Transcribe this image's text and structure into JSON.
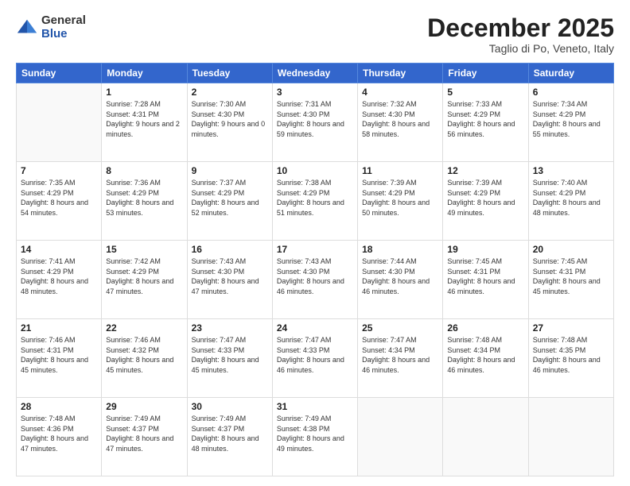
{
  "logo": {
    "general": "General",
    "blue": "Blue"
  },
  "header": {
    "month": "December 2025",
    "location": "Taglio di Po, Veneto, Italy"
  },
  "days_of_week": [
    "Sunday",
    "Monday",
    "Tuesday",
    "Wednesday",
    "Thursday",
    "Friday",
    "Saturday"
  ],
  "weeks": [
    [
      {
        "day": "",
        "sunrise": "",
        "sunset": "",
        "daylight": ""
      },
      {
        "day": "1",
        "sunrise": "Sunrise: 7:28 AM",
        "sunset": "Sunset: 4:31 PM",
        "daylight": "Daylight: 9 hours and 2 minutes."
      },
      {
        "day": "2",
        "sunrise": "Sunrise: 7:30 AM",
        "sunset": "Sunset: 4:30 PM",
        "daylight": "Daylight: 9 hours and 0 minutes."
      },
      {
        "day": "3",
        "sunrise": "Sunrise: 7:31 AM",
        "sunset": "Sunset: 4:30 PM",
        "daylight": "Daylight: 8 hours and 59 minutes."
      },
      {
        "day": "4",
        "sunrise": "Sunrise: 7:32 AM",
        "sunset": "Sunset: 4:30 PM",
        "daylight": "Daylight: 8 hours and 58 minutes."
      },
      {
        "day": "5",
        "sunrise": "Sunrise: 7:33 AM",
        "sunset": "Sunset: 4:29 PM",
        "daylight": "Daylight: 8 hours and 56 minutes."
      },
      {
        "day": "6",
        "sunrise": "Sunrise: 7:34 AM",
        "sunset": "Sunset: 4:29 PM",
        "daylight": "Daylight: 8 hours and 55 minutes."
      }
    ],
    [
      {
        "day": "7",
        "sunrise": "Sunrise: 7:35 AM",
        "sunset": "Sunset: 4:29 PM",
        "daylight": "Daylight: 8 hours and 54 minutes."
      },
      {
        "day": "8",
        "sunrise": "Sunrise: 7:36 AM",
        "sunset": "Sunset: 4:29 PM",
        "daylight": "Daylight: 8 hours and 53 minutes."
      },
      {
        "day": "9",
        "sunrise": "Sunrise: 7:37 AM",
        "sunset": "Sunset: 4:29 PM",
        "daylight": "Daylight: 8 hours and 52 minutes."
      },
      {
        "day": "10",
        "sunrise": "Sunrise: 7:38 AM",
        "sunset": "Sunset: 4:29 PM",
        "daylight": "Daylight: 8 hours and 51 minutes."
      },
      {
        "day": "11",
        "sunrise": "Sunrise: 7:39 AM",
        "sunset": "Sunset: 4:29 PM",
        "daylight": "Daylight: 8 hours and 50 minutes."
      },
      {
        "day": "12",
        "sunrise": "Sunrise: 7:39 AM",
        "sunset": "Sunset: 4:29 PM",
        "daylight": "Daylight: 8 hours and 49 minutes."
      },
      {
        "day": "13",
        "sunrise": "Sunrise: 7:40 AM",
        "sunset": "Sunset: 4:29 PM",
        "daylight": "Daylight: 8 hours and 48 minutes."
      }
    ],
    [
      {
        "day": "14",
        "sunrise": "Sunrise: 7:41 AM",
        "sunset": "Sunset: 4:29 PM",
        "daylight": "Daylight: 8 hours and 48 minutes."
      },
      {
        "day": "15",
        "sunrise": "Sunrise: 7:42 AM",
        "sunset": "Sunset: 4:29 PM",
        "daylight": "Daylight: 8 hours and 47 minutes."
      },
      {
        "day": "16",
        "sunrise": "Sunrise: 7:43 AM",
        "sunset": "Sunset: 4:30 PM",
        "daylight": "Daylight: 8 hours and 47 minutes."
      },
      {
        "day": "17",
        "sunrise": "Sunrise: 7:43 AM",
        "sunset": "Sunset: 4:30 PM",
        "daylight": "Daylight: 8 hours and 46 minutes."
      },
      {
        "day": "18",
        "sunrise": "Sunrise: 7:44 AM",
        "sunset": "Sunset: 4:30 PM",
        "daylight": "Daylight: 8 hours and 46 minutes."
      },
      {
        "day": "19",
        "sunrise": "Sunrise: 7:45 AM",
        "sunset": "Sunset: 4:31 PM",
        "daylight": "Daylight: 8 hours and 46 minutes."
      },
      {
        "day": "20",
        "sunrise": "Sunrise: 7:45 AM",
        "sunset": "Sunset: 4:31 PM",
        "daylight": "Daylight: 8 hours and 45 minutes."
      }
    ],
    [
      {
        "day": "21",
        "sunrise": "Sunrise: 7:46 AM",
        "sunset": "Sunset: 4:31 PM",
        "daylight": "Daylight: 8 hours and 45 minutes."
      },
      {
        "day": "22",
        "sunrise": "Sunrise: 7:46 AM",
        "sunset": "Sunset: 4:32 PM",
        "daylight": "Daylight: 8 hours and 45 minutes."
      },
      {
        "day": "23",
        "sunrise": "Sunrise: 7:47 AM",
        "sunset": "Sunset: 4:33 PM",
        "daylight": "Daylight: 8 hours and 45 minutes."
      },
      {
        "day": "24",
        "sunrise": "Sunrise: 7:47 AM",
        "sunset": "Sunset: 4:33 PM",
        "daylight": "Daylight: 8 hours and 46 minutes."
      },
      {
        "day": "25",
        "sunrise": "Sunrise: 7:47 AM",
        "sunset": "Sunset: 4:34 PM",
        "daylight": "Daylight: 8 hours and 46 minutes."
      },
      {
        "day": "26",
        "sunrise": "Sunrise: 7:48 AM",
        "sunset": "Sunset: 4:34 PM",
        "daylight": "Daylight: 8 hours and 46 minutes."
      },
      {
        "day": "27",
        "sunrise": "Sunrise: 7:48 AM",
        "sunset": "Sunset: 4:35 PM",
        "daylight": "Daylight: 8 hours and 46 minutes."
      }
    ],
    [
      {
        "day": "28",
        "sunrise": "Sunrise: 7:48 AM",
        "sunset": "Sunset: 4:36 PM",
        "daylight": "Daylight: 8 hours and 47 minutes."
      },
      {
        "day": "29",
        "sunrise": "Sunrise: 7:49 AM",
        "sunset": "Sunset: 4:37 PM",
        "daylight": "Daylight: 8 hours and 47 minutes."
      },
      {
        "day": "30",
        "sunrise": "Sunrise: 7:49 AM",
        "sunset": "Sunset: 4:37 PM",
        "daylight": "Daylight: 8 hours and 48 minutes."
      },
      {
        "day": "31",
        "sunrise": "Sunrise: 7:49 AM",
        "sunset": "Sunset: 4:38 PM",
        "daylight": "Daylight: 8 hours and 49 minutes."
      },
      {
        "day": "",
        "sunrise": "",
        "sunset": "",
        "daylight": ""
      },
      {
        "day": "",
        "sunrise": "",
        "sunset": "",
        "daylight": ""
      },
      {
        "day": "",
        "sunrise": "",
        "sunset": "",
        "daylight": ""
      }
    ]
  ]
}
